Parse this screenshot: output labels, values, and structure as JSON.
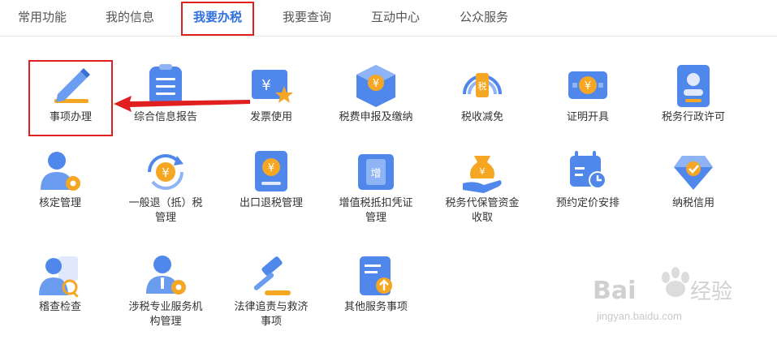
{
  "tabs": [
    {
      "label": "常用功能"
    },
    {
      "label": "我的信息"
    },
    {
      "label": "我要办税"
    },
    {
      "label": "我要查询"
    },
    {
      "label": "互动中心"
    },
    {
      "label": "公众服务"
    }
  ],
  "active_tab_index": 2,
  "items": [
    {
      "label": "事项办理",
      "icon": "pencil-icon"
    },
    {
      "label": "综合信息报告",
      "icon": "document-list-icon"
    },
    {
      "label": "发票使用",
      "icon": "invoice-star-icon"
    },
    {
      "label": "税费申报及缴纳",
      "icon": "tax-cube-icon"
    },
    {
      "label": "税收减免",
      "icon": "tax-reduction-icon"
    },
    {
      "label": "证明开具",
      "icon": "certificate-icon"
    },
    {
      "label": "税务行政许可",
      "icon": "admin-permit-icon"
    },
    {
      "label": "核定管理",
      "icon": "user-gear-icon"
    },
    {
      "label": "一般退（抵）税管理",
      "icon": "refund-cycle-icon",
      "line1": "一般退（抵）税",
      "line2": "管理"
    },
    {
      "label": "出口退税管理",
      "icon": "export-book-icon"
    },
    {
      "label": "增值税抵扣凭证管理",
      "icon": "vat-ticket-icon",
      "line1": "增值税抵扣凭证",
      "line2": "管理"
    },
    {
      "label": "税务代保管资金收取",
      "icon": "money-bag-hand-icon",
      "line1": "税务代保管资金",
      "line2": "收取"
    },
    {
      "label": "预约定价安排",
      "icon": "calendar-clock-icon"
    },
    {
      "label": "纳税信用",
      "icon": "credit-diamond-icon"
    },
    {
      "label": "稽查检查",
      "icon": "inspector-icon"
    },
    {
      "label": "涉税专业服务机构管理",
      "icon": "agent-gear-icon",
      "line1": "涉税专业服务机",
      "line2": "构管理"
    },
    {
      "label": "法律追责与救济事项",
      "icon": "gavel-icon",
      "line1": "法律追责与救济",
      "line2": "事项"
    },
    {
      "label": "其他服务事项",
      "icon": "clipboard-upload-icon"
    }
  ],
  "watermark": {
    "text": "jingyan.baidu.com",
    "brand": "Baidu经验"
  },
  "colors": {
    "accent": "#2f6fe0",
    "highlight": "#e02020",
    "orange": "#f5a623"
  }
}
